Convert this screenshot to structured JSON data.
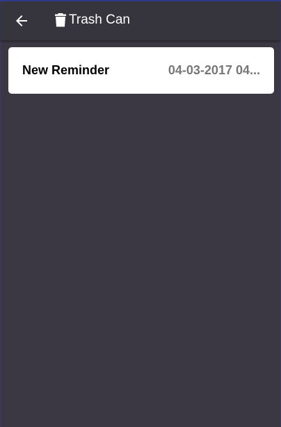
{
  "header": {
    "title": "Trash Can",
    "back_icon": "arrow-left-icon",
    "title_icon": "trash-icon"
  },
  "items": [
    {
      "title": "New Reminder",
      "date": "04-03-2017 04..."
    }
  ],
  "colors": {
    "background": "#3b3843",
    "header": "#36343d",
    "card": "#ffffff",
    "date": "#777777"
  }
}
